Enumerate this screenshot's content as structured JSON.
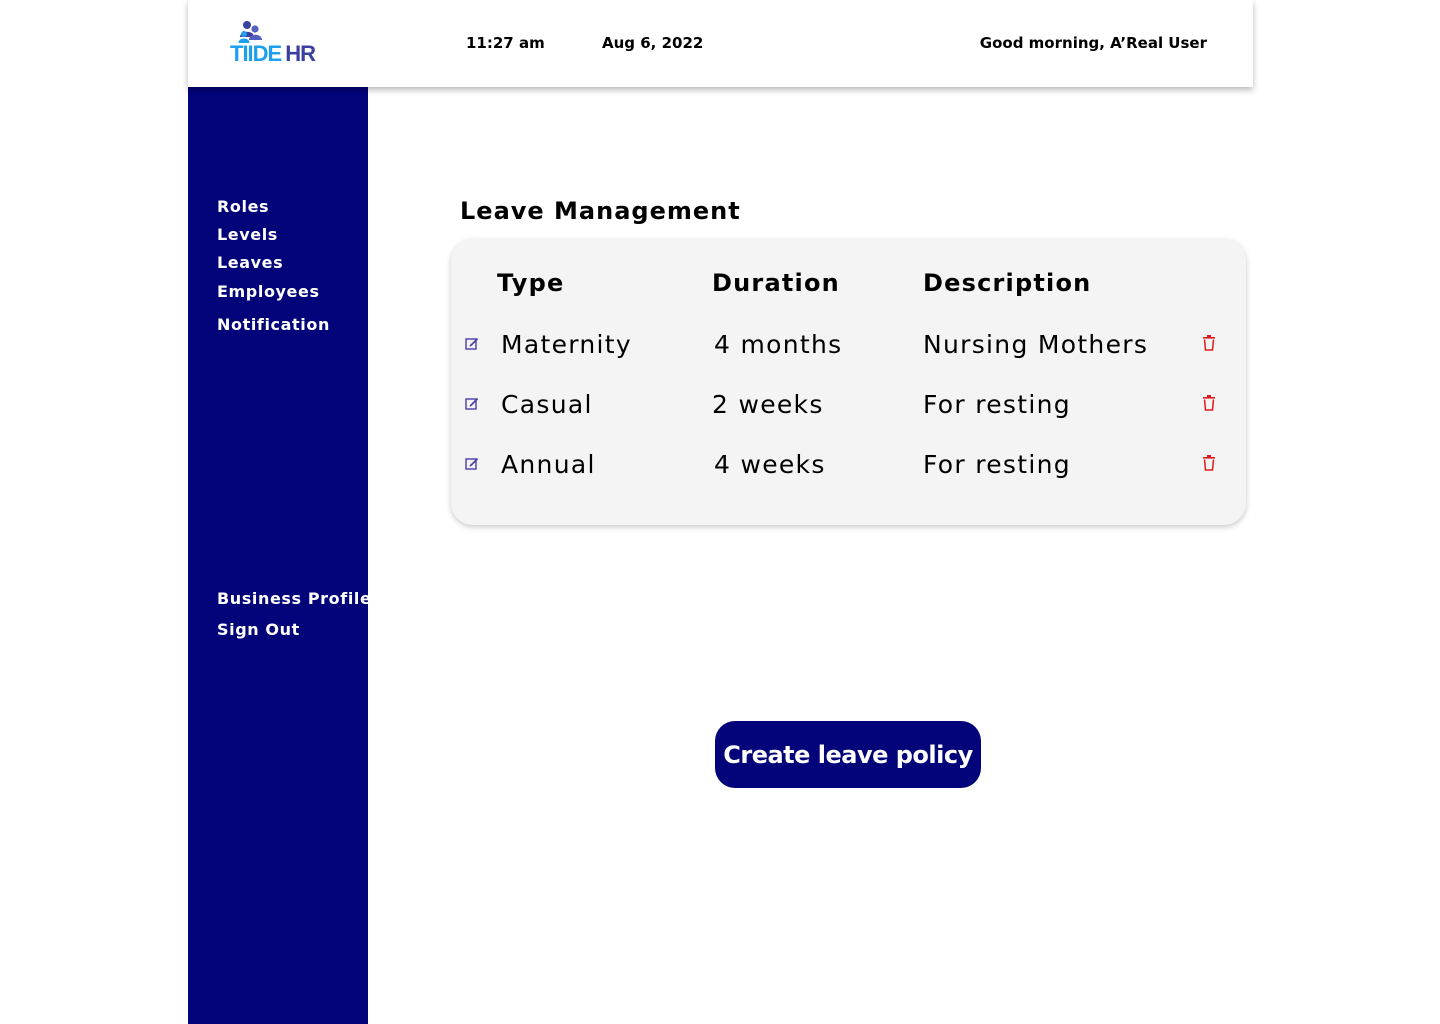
{
  "header": {
    "logo": {
      "part1": "TIIDE",
      "part2": "HR",
      "icon": "people-icon",
      "colors": [
        "#1ea0f0",
        "#3b3fa0"
      ]
    },
    "time": "11:27 am",
    "date": "Aug 6, 2022",
    "greeting": "Good morning, A’Real User"
  },
  "sidebar": {
    "background": "#03037a",
    "items": [
      {
        "label": "Roles"
      },
      {
        "label": "Levels"
      },
      {
        "label": "Leaves"
      },
      {
        "label": "Employees"
      },
      {
        "label": "Notification"
      }
    ],
    "bottom_items": [
      {
        "label": "Business Profile"
      },
      {
        "label": "Sign Out"
      }
    ]
  },
  "main": {
    "title": "Leave Management",
    "table": {
      "headers": {
        "type": "Type",
        "duration": "Duration",
        "description": "Description"
      },
      "rows": [
        {
          "type": "Maternity",
          "duration": "4 months",
          "description": "Nursing Mothers"
        },
        {
          "type": "Casual",
          "duration": "2 weeks",
          "description": "For resting"
        },
        {
          "type": "Annual",
          "duration": "4 weeks",
          "description": "For resting"
        }
      ],
      "row_icons": {
        "edit": "edit-icon",
        "delete": "trash-icon"
      },
      "colors": {
        "edit": "#4a3fa8",
        "delete": "#e0191f"
      }
    },
    "create_button": {
      "label": "Create leave policy",
      "color": "#03037a"
    }
  }
}
